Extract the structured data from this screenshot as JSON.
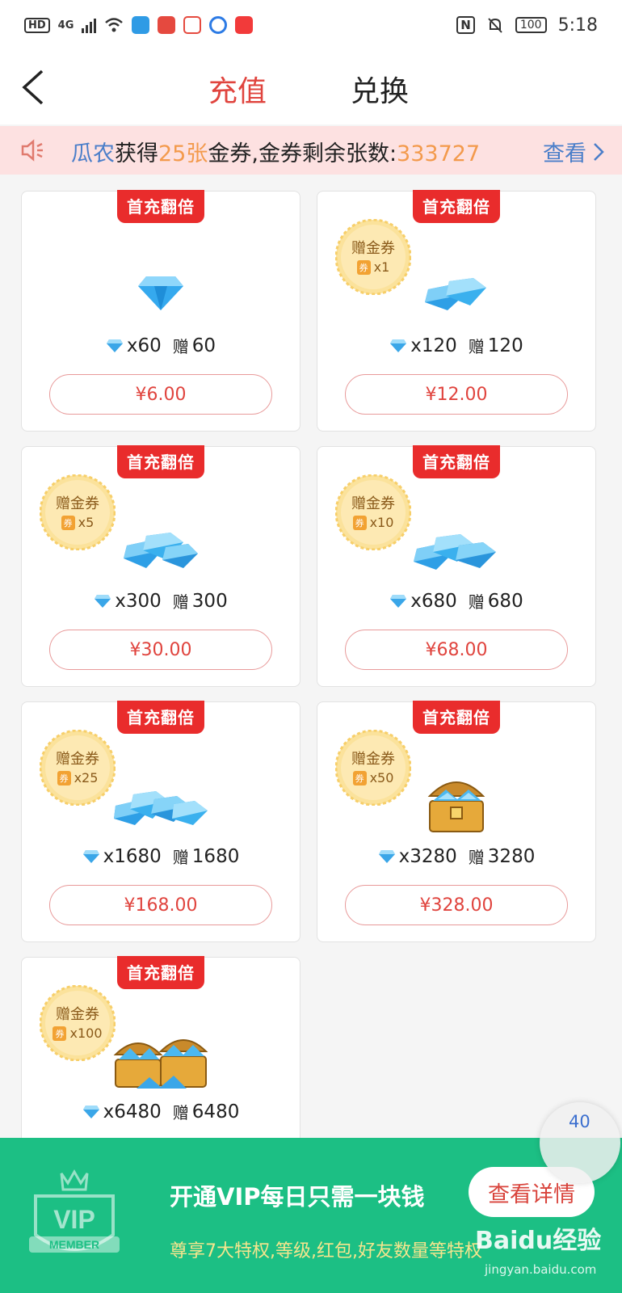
{
  "status_bar": {
    "hd": "HD",
    "network": "4G",
    "nfc": "N",
    "battery": "100",
    "time": "5:18"
  },
  "header": {
    "tabs": [
      {
        "label": "充值"
      },
      {
        "label": "兑换"
      }
    ]
  },
  "notice": {
    "user": "瓜农",
    "got": "获得",
    "count_text": "25张",
    "rest": "金券,金券剩余张数:",
    "remaining": "333727",
    "view_label": "查看"
  },
  "packages": [
    {
      "ribbon": "首充翻倍",
      "amount": "x60",
      "bonus_word": "赠",
      "bonus": "60",
      "price": "¥6.00"
    },
    {
      "ribbon": "首充翻倍",
      "coupon_title": "赠金券",
      "coupon_icon_text": "券",
      "coupon_count": "x1",
      "amount": "x120",
      "bonus_word": "赠",
      "bonus": "120",
      "price": "¥12.00"
    },
    {
      "ribbon": "首充翻倍",
      "coupon_title": "赠金券",
      "coupon_icon_text": "券",
      "coupon_count": "x5",
      "amount": "x300",
      "bonus_word": "赠",
      "bonus": "300",
      "price": "¥30.00"
    },
    {
      "ribbon": "首充翻倍",
      "coupon_title": "赠金券",
      "coupon_icon_text": "券",
      "coupon_count": "x10",
      "amount": "x680",
      "bonus_word": "赠",
      "bonus": "680",
      "price": "¥68.00"
    },
    {
      "ribbon": "首充翻倍",
      "coupon_title": "赠金券",
      "coupon_icon_text": "券",
      "coupon_count": "x25",
      "amount": "x1680",
      "bonus_word": "赠",
      "bonus": "1680",
      "price": "¥168.00"
    },
    {
      "ribbon": "首充翻倍",
      "coupon_title": "赠金券",
      "coupon_icon_text": "券",
      "coupon_count": "x50",
      "amount": "x3280",
      "bonus_word": "赠",
      "bonus": "3280",
      "price": "¥328.00"
    },
    {
      "ribbon": "首充翻倍",
      "coupon_title": "赠金券",
      "coupon_icon_text": "券",
      "coupon_count": "x100",
      "amount": "x6480",
      "bonus_word": "赠",
      "bonus": "6480"
    }
  ],
  "vip_banner": {
    "logo_text": "VIP",
    "logo_sub": "MEMBER",
    "title": "开通VIP每日只需一块钱",
    "subtitle": "尊享7大特权,等级,红包,好友数量等特权",
    "button": "查看详情"
  },
  "float_bubble": {
    "count": "40"
  },
  "watermark": {
    "brand": "Baidu经验",
    "url": "jingyan.baidu.com"
  },
  "colors": {
    "accent_red": "#e0443e",
    "ribbon_red": "#e92c2c",
    "notice_bg": "#fde1e1",
    "vip_green": "#1cbf84",
    "link_blue": "#4a7ec9",
    "highlight_orange": "#f39a4c"
  }
}
